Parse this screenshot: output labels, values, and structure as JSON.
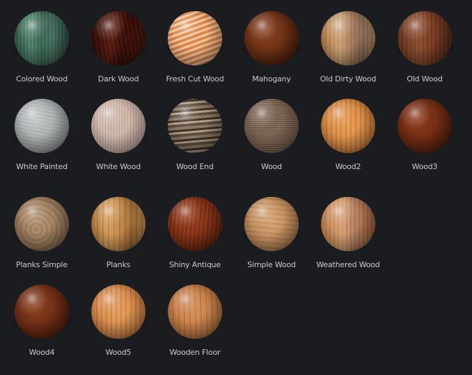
{
  "materials": [
    {
      "label": "Colored Wood",
      "color": "#3e6f5c",
      "accent": "#2a4a3f"
    },
    {
      "label": "Dark Wood",
      "color": "#4a1712",
      "accent": "#2a0906"
    },
    {
      "label": "Fresh Cut Wood",
      "color": "#e39a5e",
      "accent": "#f3c79b"
    },
    {
      "label": "Mahogany",
      "color": "#6a2e14",
      "accent": "#4a1c0a"
    },
    {
      "label": "Old Dirty Wood",
      "color": "#b77b48",
      "accent": "#8e5a33"
    },
    {
      "label": "Old Wood",
      "color": "#7a3d24",
      "accent": "#5a2a18"
    },
    {
      "label": "White Painted",
      "color": "#a9acac",
      "accent": "#8c8f8f"
    },
    {
      "label": "White Wood",
      "color": "#c9b0a5",
      "accent": "#ad9286"
    },
    {
      "label": "Wood End",
      "color": "#6e5c4c",
      "accent": "#3f3026"
    },
    {
      "label": "Wood",
      "color": "#7a6150",
      "accent": "#5a4536"
    },
    {
      "label": "Wood2",
      "color": "#d98a42",
      "accent": "#b56628"
    },
    {
      "label": "Wood3",
      "color": "#6c2a12",
      "accent": "#4e1c08"
    },
    {
      "label": "Planks Simple",
      "color": "#9a7858",
      "accent": "#7a5c42"
    },
    {
      "label": "Planks",
      "color": "#c68a4a",
      "accent": "#a06a34"
    },
    {
      "label": "Shiny Antique",
      "color": "#7a2c12",
      "accent": "#5a1c08"
    },
    {
      "label": "Simple Wood",
      "color": "#c08a5a",
      "accent": "#9e6e44"
    },
    {
      "label": "Weathered Wood",
      "color": "#c4804c",
      "accent": "#a06038"
    },
    {
      "label": "Wood4",
      "color": "#6a2c14",
      "accent": "#4a1a08"
    },
    {
      "label": "Wood5",
      "color": "#d6884a",
      "accent": "#b86a30"
    },
    {
      "label": "Wooden Floor",
      "color": "#c27a44",
      "accent": "#a45f30"
    }
  ]
}
